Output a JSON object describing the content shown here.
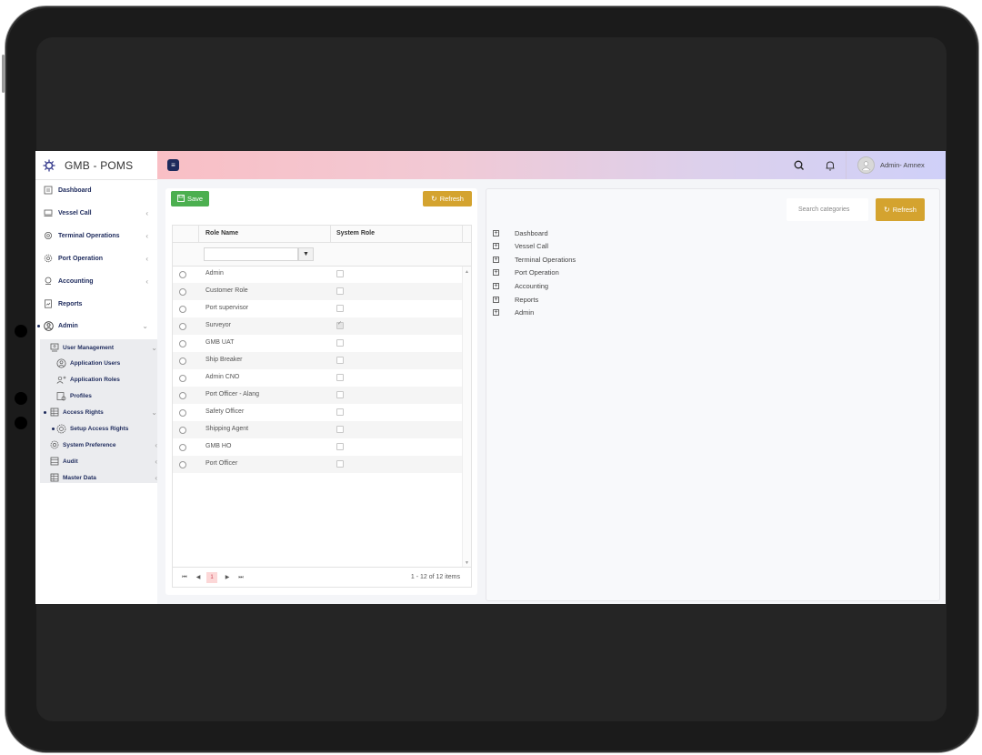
{
  "app": {
    "title": "GMB - POMS"
  },
  "sidebar": {
    "items": [
      {
        "label": "Dashboard",
        "icon": "dashboard-icon",
        "has_chevron": false
      },
      {
        "label": "Vessel Call",
        "icon": "ship-icon",
        "has_chevron": true
      },
      {
        "label": "Terminal Operations",
        "icon": "terminal-icon",
        "has_chevron": true
      },
      {
        "label": "Port Operation",
        "icon": "gear-icon",
        "has_chevron": true
      },
      {
        "label": "Accounting",
        "icon": "accounting-icon",
        "has_chevron": true
      },
      {
        "label": "Reports",
        "icon": "reports-icon",
        "has_chevron": false
      },
      {
        "label": "Admin",
        "icon": "user-circle-icon",
        "has_chevron": true
      }
    ],
    "admin_submenu": [
      {
        "label": "User Management",
        "icon": "user-management-icon",
        "level": 1
      },
      {
        "label": "Application Users",
        "icon": "user-icon",
        "level": 2
      },
      {
        "label": "Application Roles",
        "icon": "roles-icon",
        "level": 2
      },
      {
        "label": "Profiles",
        "icon": "profile-icon",
        "level": 2
      },
      {
        "label": "Access Rights",
        "icon": "access-icon",
        "level": 1
      },
      {
        "label": "Setup Access Rights",
        "icon": "setup-icon",
        "level": 2
      },
      {
        "label": "System Preference",
        "icon": "preference-icon",
        "level": 1
      },
      {
        "label": "Audit",
        "icon": "audit-icon",
        "level": 1
      },
      {
        "label": "Master Data",
        "icon": "master-data-icon",
        "level": 1
      }
    ]
  },
  "header": {
    "user_name": "Admin- Amnex"
  },
  "toolbar": {
    "save_label": "Save",
    "refresh_label": "Refresh"
  },
  "roles_grid": {
    "columns": [
      "Role Name",
      "System Role"
    ],
    "rows": [
      {
        "name": "Admin",
        "system_role": false
      },
      {
        "name": "Customer Role",
        "system_role": false
      },
      {
        "name": "Port supervisor",
        "system_role": false
      },
      {
        "name": "Surveyor",
        "system_role": true
      },
      {
        "name": "GMB UAT",
        "system_role": false
      },
      {
        "name": "Ship Breaker",
        "system_role": false
      },
      {
        "name": "Admin CNO",
        "system_role": false
      },
      {
        "name": "Port Officer - Alang",
        "system_role": false
      },
      {
        "name": "Safety Officer",
        "system_role": false
      },
      {
        "name": "Shipping Agent",
        "system_role": false
      },
      {
        "name": "GMB HO",
        "system_role": false
      },
      {
        "name": "Port Officer",
        "system_role": false
      }
    ],
    "pager": {
      "current_page": "1",
      "info": "1 - 12 of 12 items"
    }
  },
  "categories": {
    "search_placeholder": "Search categories",
    "refresh_label": "Refresh",
    "tree": [
      "Dashboard",
      "Vessel Call",
      "Terminal Operations",
      "Port Operation",
      "Accounting",
      "Reports",
      "Admin"
    ]
  },
  "colors": {
    "save_button": "#4caf50",
    "refresh_button": "#d4a32f",
    "nav_text": "#1d2a5c",
    "pager_active": "#fcd7d7"
  }
}
